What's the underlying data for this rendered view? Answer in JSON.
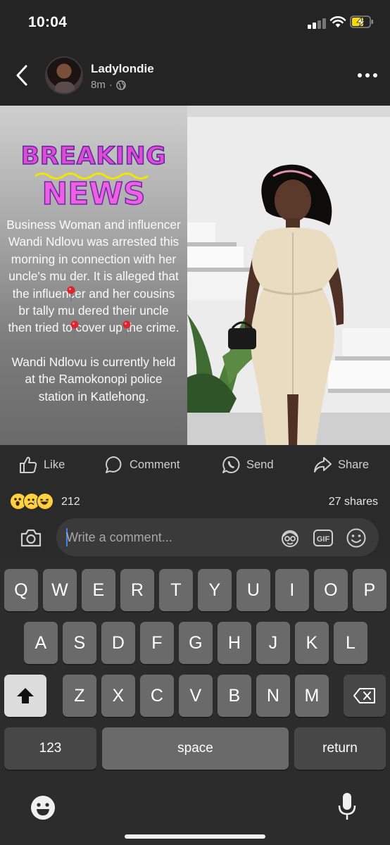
{
  "status_bar": {
    "time": "10:04"
  },
  "post": {
    "author": "Ladylondie",
    "time_ago": "8m",
    "visibility_icon": "globe-icon",
    "image": {
      "headline_1": "BREAKING",
      "headline_2": "NEWS",
      "paragraph_1": "Business Woman and influencer Wandi Ndlovu was arrested this morning in connection with her uncle's mu der. It is alleged that the influencer and her cousins br tally mu dered their uncle then tried to cover up the crime.",
      "paragraph_2": "Wandi Ndlovu is currently held at the Ramokonopi police station in Katlehong."
    }
  },
  "actions": {
    "like": "Like",
    "comment": "Comment",
    "send": "Send",
    "share": "Share"
  },
  "engagement": {
    "reaction_icons": [
      "wow-emoji",
      "sad-emoji",
      "haha-emoji"
    ],
    "reaction_count": "212",
    "shares": "27 shares"
  },
  "comment_bar": {
    "placeholder": "Write a comment..."
  },
  "keyboard": {
    "row1": [
      "Q",
      "W",
      "E",
      "R",
      "T",
      "Y",
      "U",
      "I",
      "O",
      "P"
    ],
    "row2": [
      "A",
      "S",
      "D",
      "F",
      "G",
      "H",
      "J",
      "K",
      "L"
    ],
    "row3": [
      "Z",
      "X",
      "C",
      "V",
      "B",
      "N",
      "M"
    ],
    "numbers_key": "123",
    "space_key": "space",
    "return_key": "return"
  },
  "colors": {
    "background": "#2a2a2a",
    "headline_purple": "#e04ad6",
    "caret_blue": "#3b82f6",
    "battery_yellow": "#f5d90a"
  }
}
